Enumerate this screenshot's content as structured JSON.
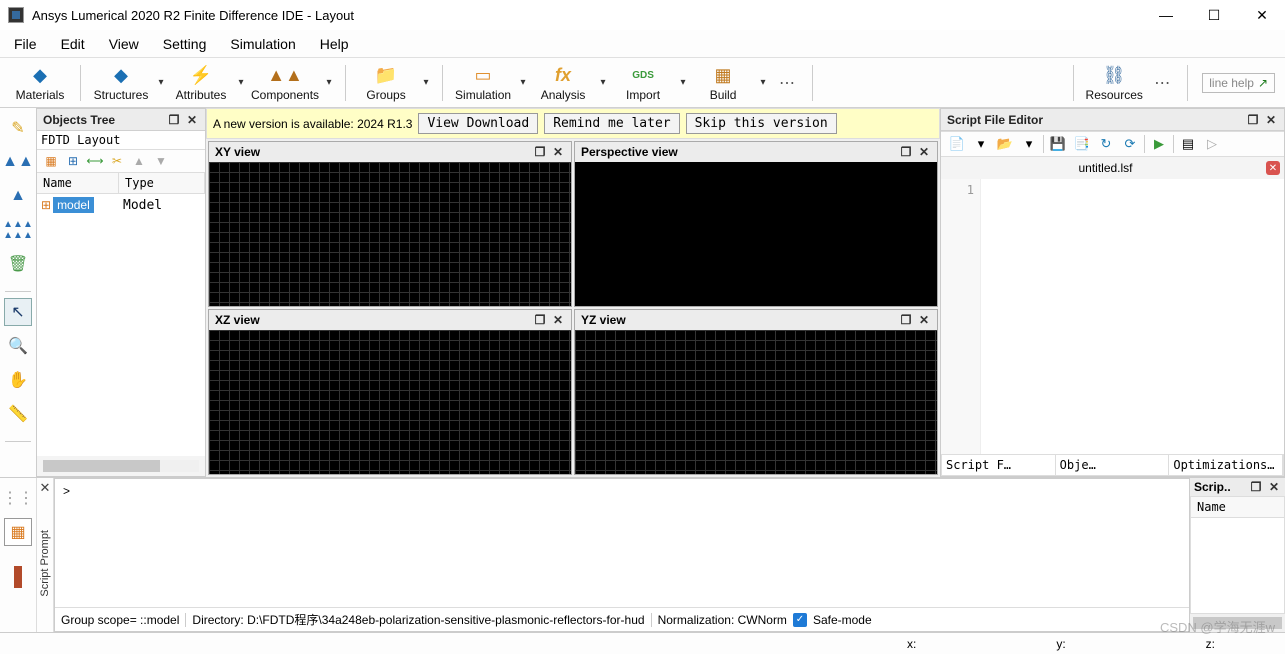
{
  "window": {
    "title": "Ansys Lumerical 2020 R2 Finite Difference IDE - Layout"
  },
  "menu": [
    "File",
    "Edit",
    "View",
    "Setting",
    "Simulation",
    "Help"
  ],
  "toolbar": [
    {
      "label": "Materials",
      "icon": "◆",
      "color": "#1b6fb3"
    },
    {
      "label": "Structures",
      "icon": "◆",
      "color": "#1b6fb3"
    },
    {
      "label": "Attributes",
      "icon": "↯",
      "color": "#b38a1b"
    },
    {
      "label": "Components",
      "icon": "▲▲",
      "color": "#b36f1b"
    },
    {
      "label": "Groups",
      "icon": "🗂",
      "color": "#e0a030"
    },
    {
      "label": "Simulation",
      "icon": "▭",
      "color": "#e09030"
    },
    {
      "label": "Analysis",
      "icon": "fx",
      "color": "#e0a030"
    },
    {
      "label": "Import",
      "icon": "GDS",
      "color": "#3a9a3a"
    },
    {
      "label": "Build",
      "icon": "▦",
      "color": "#c07a20"
    }
  ],
  "toolbar_right": {
    "resources": "Resources",
    "search_placeholder": "line help",
    "arrow": "↗"
  },
  "objects_tree": {
    "title": "Objects Tree",
    "subtitle": "FDTD Layout",
    "columns": [
      "Name",
      "Type"
    ],
    "rows": [
      {
        "name": "model",
        "type": "Model"
      }
    ]
  },
  "notice": {
    "msg": "A new version is available: 2024 R1.3",
    "btn1": "View Download",
    "btn2": "Remind me later",
    "btn3": "Skip this version"
  },
  "views": [
    "XY view",
    "Perspective view",
    "XZ view",
    "YZ view"
  ],
  "script_editor": {
    "title": "Script File Editor",
    "filename": "untitled.lsf",
    "line_no": "1",
    "tabs": [
      "Script F…",
      "Obje…",
      "Optimizations …"
    ]
  },
  "script_prompt": {
    "label": "Script Prompt",
    "prompt": ">",
    "status_scope": "Group scope= ::model",
    "status_dir": "Directory: D:\\FDTD程序\\34a248eb-polarization-sensitive-plasmonic-reflectors-for-hud",
    "status_norm": "Normalization: CWNorm",
    "status_safe": "Safe-mode"
  },
  "right_bottom": {
    "title": "Scrip..",
    "col": "Name"
  },
  "statusbar": {
    "x": "x:",
    "y": "y:",
    "z": "z:"
  },
  "watermark": "CSDN @学海无涯w"
}
